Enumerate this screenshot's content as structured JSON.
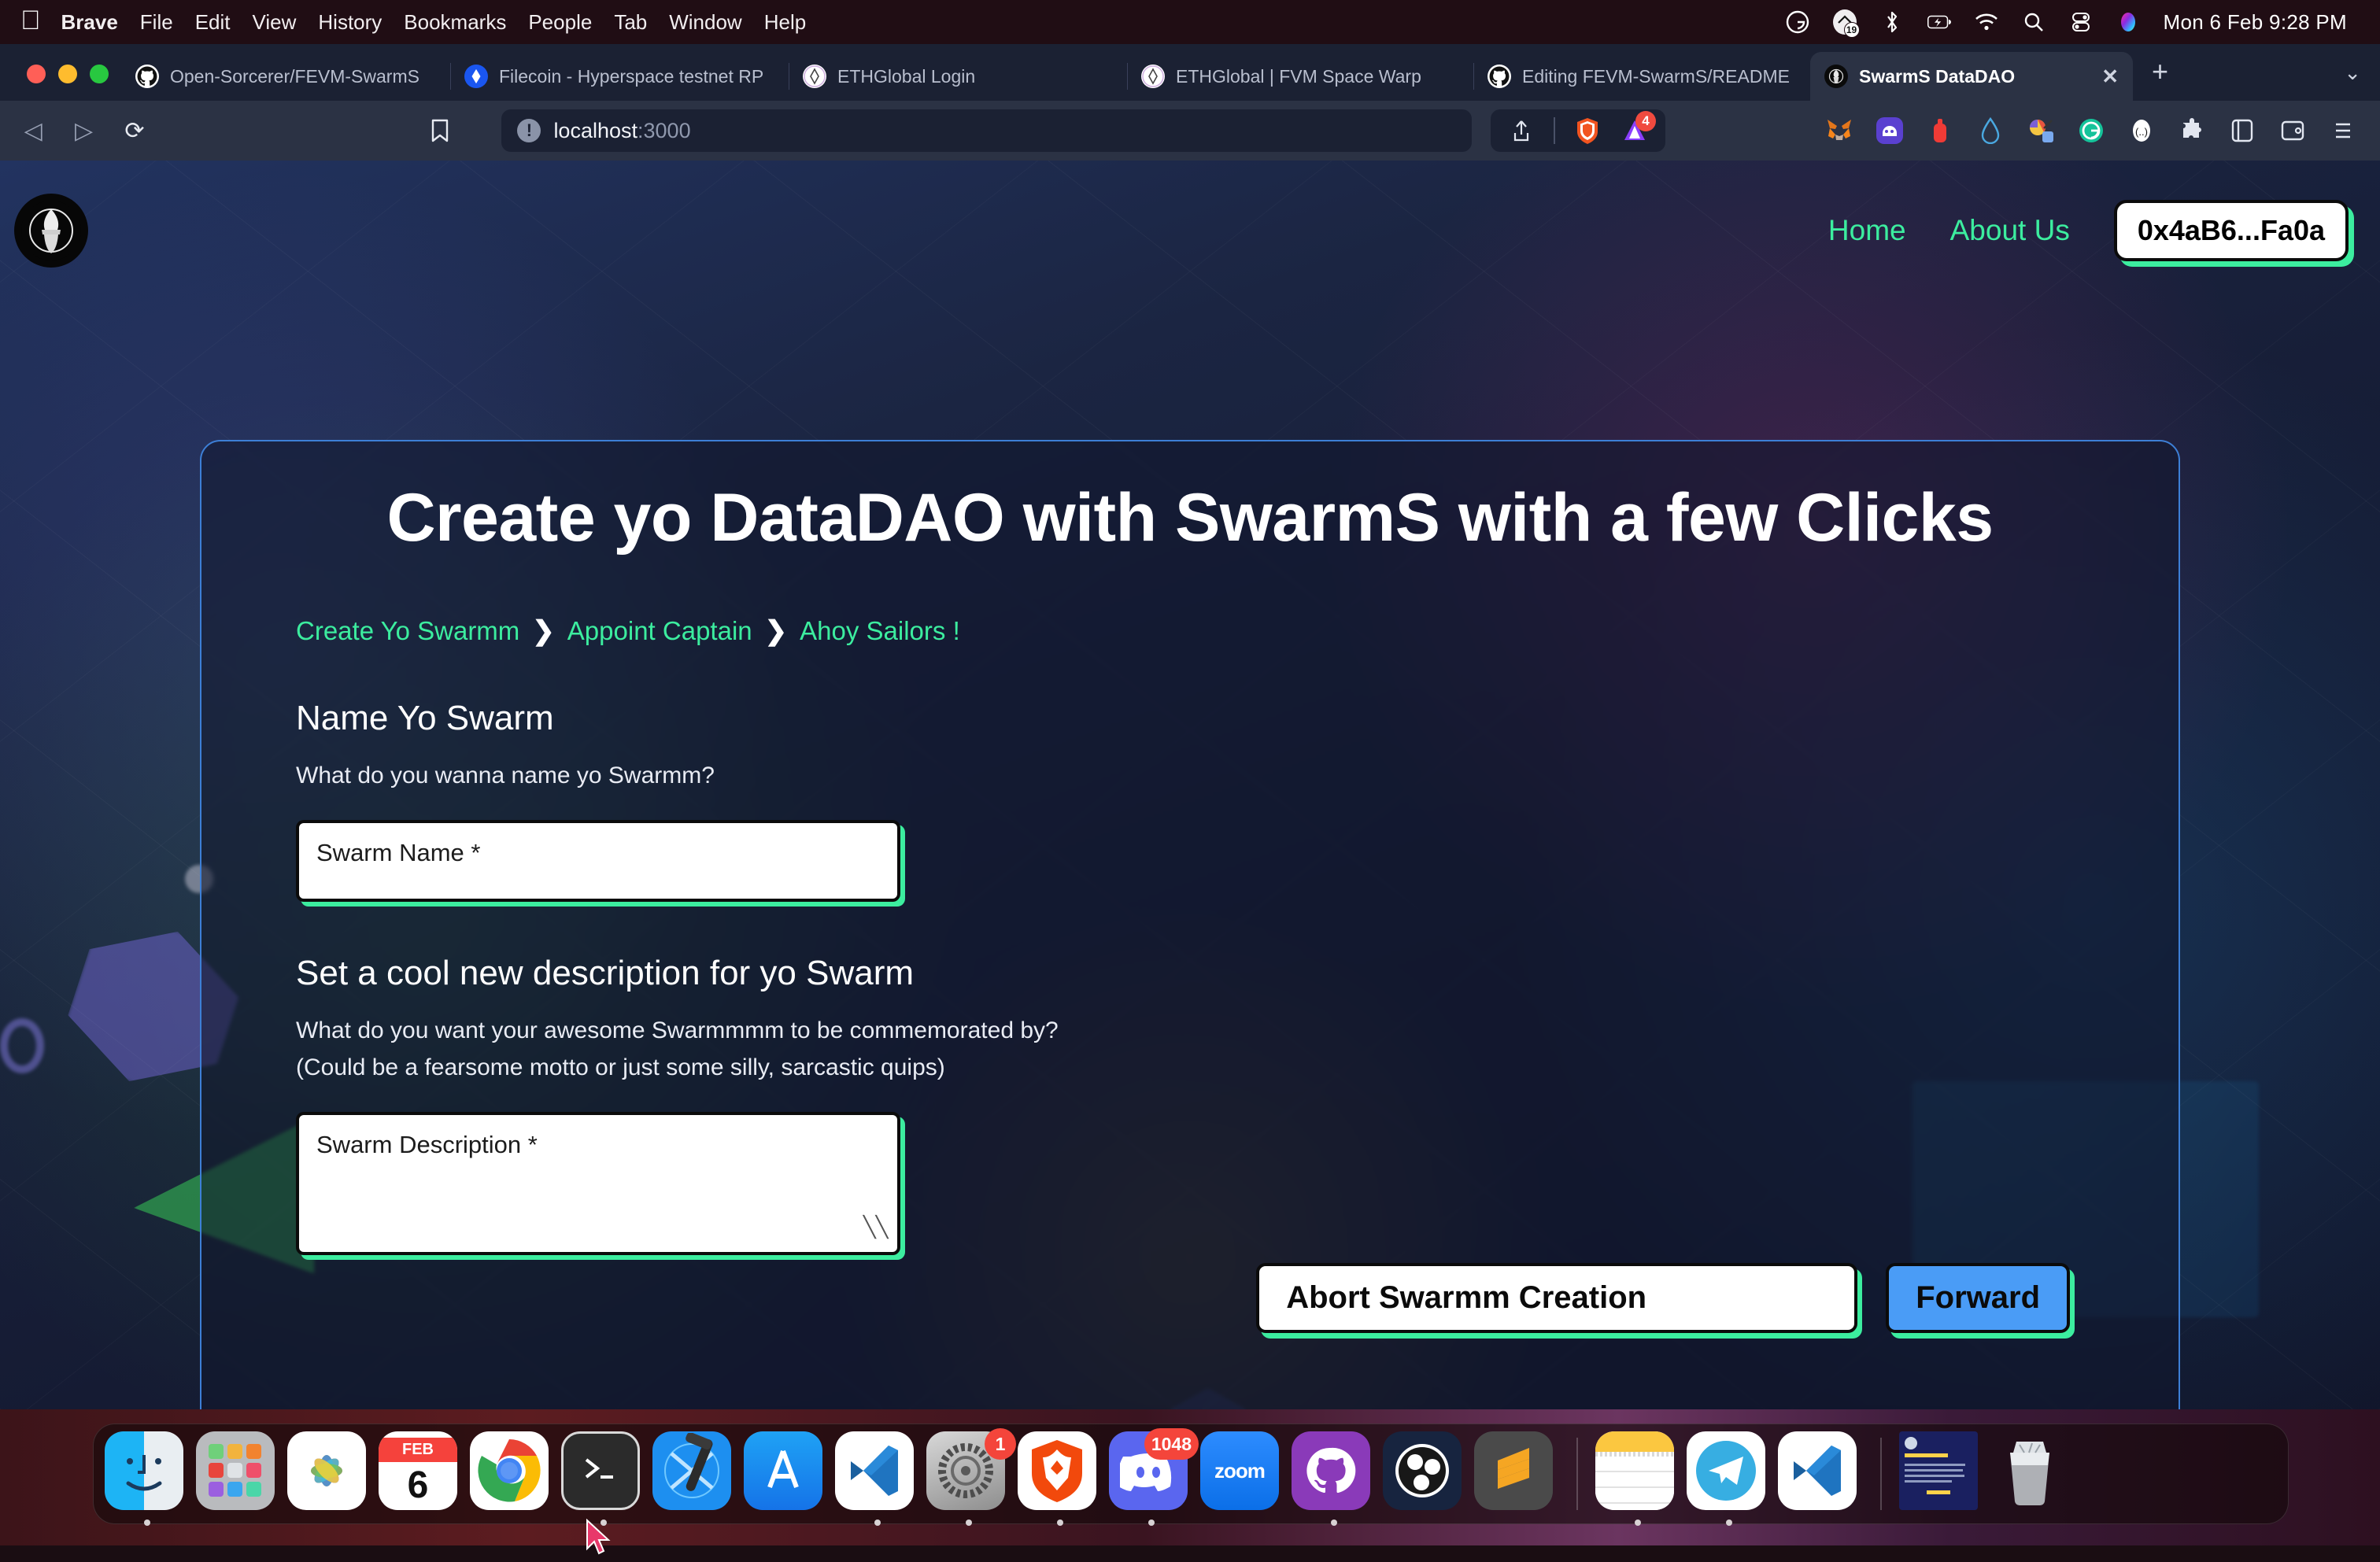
{
  "menubar": {
    "apple_icon": "apple-logo-icon",
    "items": [
      "Brave",
      "File",
      "Edit",
      "View",
      "History",
      "Bookmarks",
      "People",
      "Tab",
      "Window",
      "Help"
    ],
    "status_icons": [
      {
        "name": "grammarly-icon",
        "glyph": "G"
      },
      {
        "name": "cleanmymac-icon",
        "glyph": "19"
      },
      {
        "name": "bluetooth-icon",
        "glyph": "bluetooth"
      },
      {
        "name": "battery-charging-icon",
        "glyph": "battery"
      },
      {
        "name": "wifi-icon",
        "glyph": "wifi"
      },
      {
        "name": "spotlight-search-icon",
        "glyph": "search"
      },
      {
        "name": "control-center-icon",
        "glyph": "control"
      },
      {
        "name": "siri-icon",
        "glyph": "siri"
      }
    ],
    "clock": "Mon 6 Feb  9:28 PM"
  },
  "browser": {
    "tabs": [
      {
        "title": "Open-Sorcerer/FEVM-SwarmS",
        "favicon": "github-icon",
        "active": false
      },
      {
        "title": "Filecoin - Hyperspace testnet RP",
        "favicon": "filecoin-icon",
        "active": false
      },
      {
        "title": "ETHGlobal Login",
        "favicon": "ethglobal-icon",
        "active": false
      },
      {
        "title": "ETHGlobal | FVM Space Warp",
        "favicon": "ethglobal-icon",
        "active": false
      },
      {
        "title": "Editing FEVM-SwarmS/README",
        "favicon": "github-icon",
        "active": false
      },
      {
        "title": "SwarmS DataDAO",
        "favicon": "swarms-icon",
        "active": true
      }
    ],
    "new_tab_label": "+",
    "tab_list_label": "⌄",
    "toolbar": {
      "back_label": "◁",
      "forward_label": "▷",
      "reload_label": "⟳",
      "bookmark_label": "☐",
      "url_host": "localhost",
      "url_port": ":3000",
      "share_label": "share-icon",
      "brave_shields_label": "brave-shields-icon",
      "brave_rewards_badge": "4",
      "extensions": [
        {
          "name": "metamask-extension-icon"
        },
        {
          "name": "phantom-wallet-extension-icon"
        },
        {
          "name": "bitwarden-extension-icon"
        },
        {
          "name": "rainbow-wallet-extension-icon"
        },
        {
          "name": "colorpicker-extension-icon"
        },
        {
          "name": "grammarly-extension-icon"
        },
        {
          "name": "keplr-extension-icon"
        },
        {
          "name": "puzzle-extensions-icon"
        },
        {
          "name": "sidebar-toggle-icon"
        },
        {
          "name": "wallet-icon"
        },
        {
          "name": "brave-menu-icon"
        }
      ]
    }
  },
  "site": {
    "logo_name": "open-sorcerer-wizard-logo",
    "nav": [
      {
        "label": "Home"
      },
      {
        "label": "About Us"
      }
    ],
    "wallet_address": "0x4aB6...Fa0a",
    "card": {
      "title": "Create yo DataDAO with SwarmS with a few Clicks",
      "breadcrumb": [
        {
          "label": "Create Yo Swarmm"
        },
        {
          "label": "Appoint Captain"
        },
        {
          "label": "Ahoy Sailors !"
        }
      ],
      "breadcrumb_separator": "❯",
      "name_section": {
        "heading": "Name Yo Swarm",
        "question": "What do you wanna name yo Swarmm?",
        "input_placeholder": "Swarm Name *",
        "input_value": ""
      },
      "description_section": {
        "heading": "Set a cool new description for yo Swarm",
        "question_line1": "What do you want your awesome Swarmmmm to be commemorated by?",
        "question_line2": "(Could be a fearsome motto or just some silly, sarcastic quips)",
        "textarea_placeholder": "Swarm Description *",
        "textarea_value": ""
      },
      "buttons": {
        "abort_label": "Abort Swarmm Creation",
        "forward_label": "Forward"
      }
    },
    "colors": {
      "accent_green": "#3ced9f",
      "forward_blue": "#4a9cf6",
      "card_border": "#3d7fd6"
    }
  },
  "dock": {
    "items": [
      {
        "name": "finder",
        "badge": null,
        "running": true
      },
      {
        "name": "launchpad",
        "badge": null,
        "running": false
      },
      {
        "name": "photos",
        "badge": null,
        "running": false
      },
      {
        "name": "calendar",
        "badge": null,
        "running": false,
        "month": "FEB",
        "day": "6"
      },
      {
        "name": "google-chrome",
        "badge": null,
        "running": false
      },
      {
        "name": "terminal",
        "badge": null,
        "running": true
      },
      {
        "name": "xcode",
        "badge": null,
        "running": false
      },
      {
        "name": "app-store",
        "badge": null,
        "running": false
      },
      {
        "name": "vs-code-insiders",
        "badge": null,
        "running": true
      },
      {
        "name": "system-settings",
        "badge": "1",
        "running": true
      },
      {
        "name": "brave-browser",
        "badge": null,
        "running": true
      },
      {
        "name": "discord",
        "badge": "1048",
        "running": true
      },
      {
        "name": "zoom",
        "badge": null,
        "running": false,
        "label": "zoom"
      },
      {
        "name": "github-desktop",
        "badge": null,
        "running": true
      },
      {
        "name": "obs-studio",
        "badge": null,
        "running": false
      },
      {
        "name": "sublime-text",
        "badge": null,
        "running": false
      },
      {
        "name": "notes",
        "badge": null,
        "running": true
      },
      {
        "name": "telegram",
        "badge": null,
        "running": true
      },
      {
        "name": "vs-code",
        "badge": null,
        "running": false
      },
      {
        "name": "document-preview",
        "badge": null,
        "running": false
      },
      {
        "name": "trash",
        "badge": null,
        "running": false
      }
    ]
  }
}
